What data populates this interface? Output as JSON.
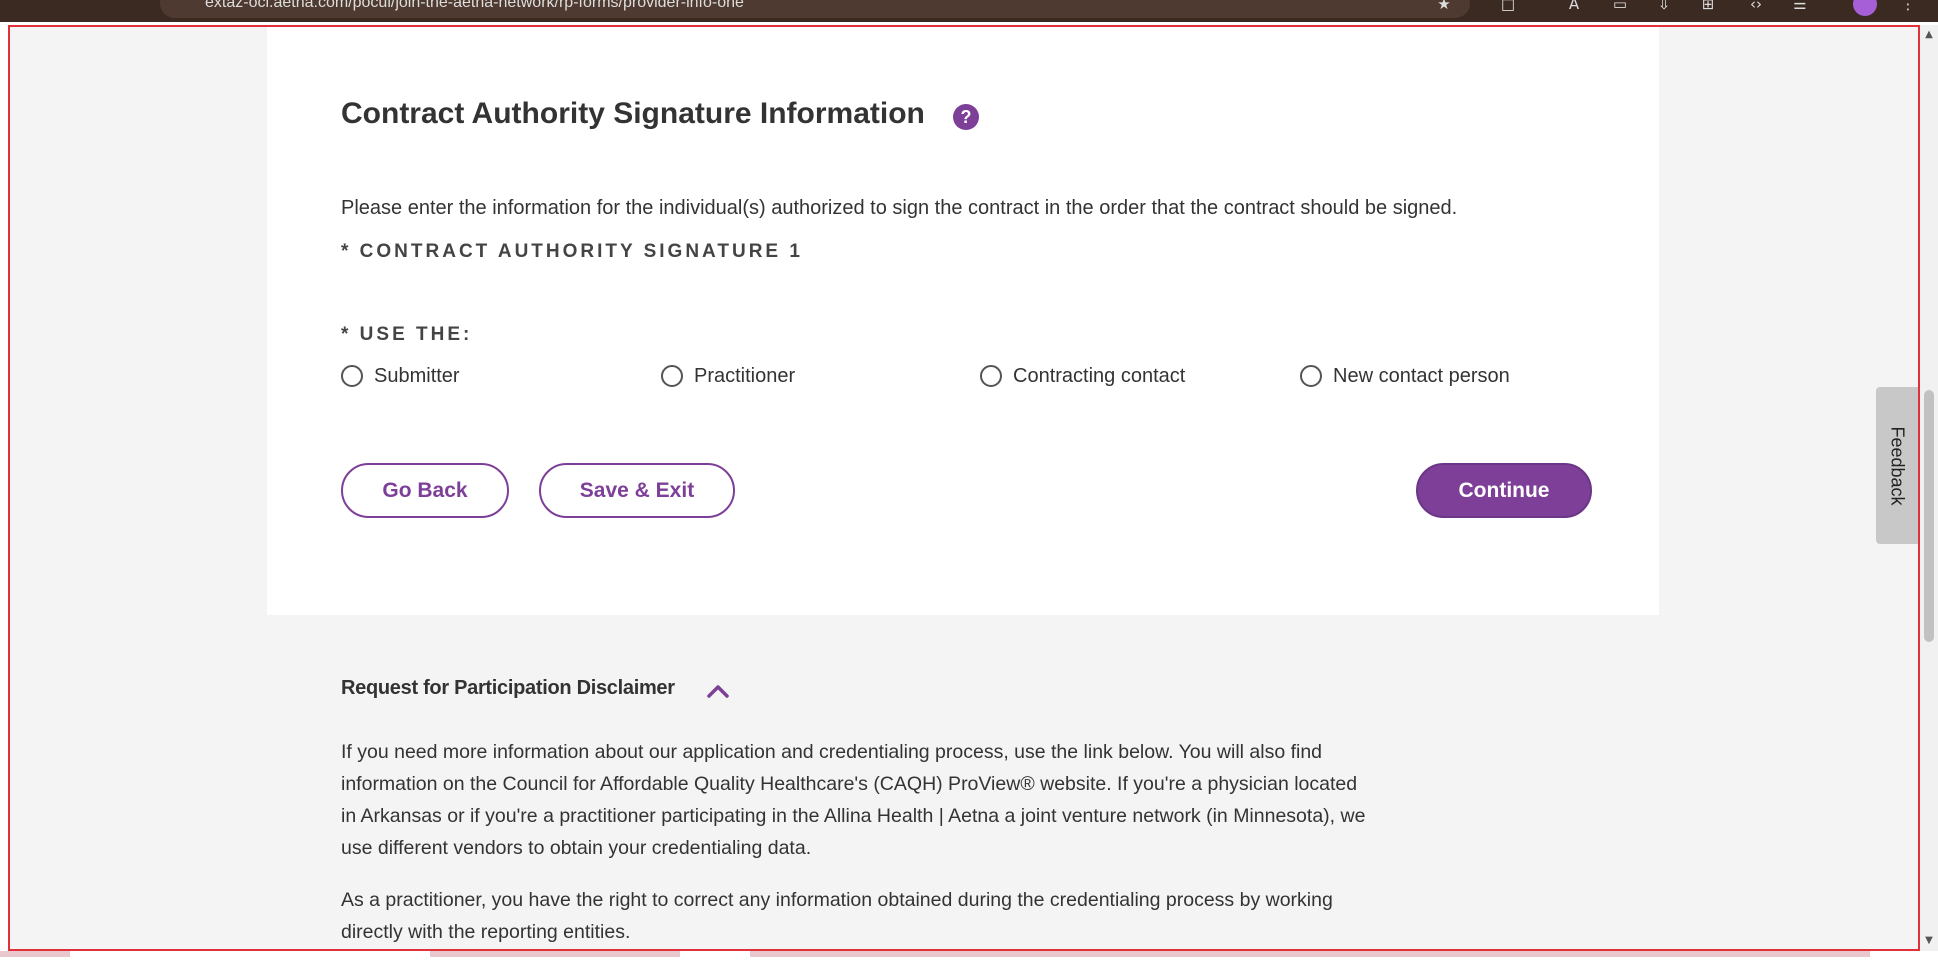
{
  "browser": {
    "url": "extaz-oci.aetna.com/pocui/join-the-aetna-network/rp-forms/provider-info-one"
  },
  "form": {
    "title": "Contract Authority Signature Information",
    "help_symbol": "?",
    "instructions": "Please enter the information for the individual(s) authorized to sign the contract in the order that the contract should be signed.",
    "signature_label": "* CONTRACT AUTHORITY SIGNATURE 1",
    "use_label": "* USE THE:",
    "options": [
      {
        "label": "Submitter",
        "selected": false
      },
      {
        "label": "Practitioner",
        "selected": false
      },
      {
        "label": "Contracting contact",
        "selected": false
      },
      {
        "label": "New contact person",
        "selected": false
      }
    ],
    "buttons": {
      "back": "Go Back",
      "save_exit": "Save & Exit",
      "continue": "Continue"
    }
  },
  "disclaimer": {
    "heading": "Request for Participation Disclaimer",
    "expanded": true,
    "paragraphs": [
      "If you need more information about our application and credentialing process, use the link below. You will also find information on the Council for Affordable Quality Healthcare's (CAQH) ProView® website. If you're a physician located in Arkansas or if you're a practitioner participating in the Allina Health | Aetna a joint venture network (in Minnesota), we use different vendors to obtain your credentialing data.",
      "As a practitioner, you have the right to correct any information obtained during the credentialing process by working directly with the reporting entities."
    ]
  },
  "feedback": {
    "label": "Feedback"
  },
  "colors": {
    "brand_purple": "#7d3f98",
    "page_bg": "#f4f4f4",
    "card_bg": "#ffffff"
  }
}
